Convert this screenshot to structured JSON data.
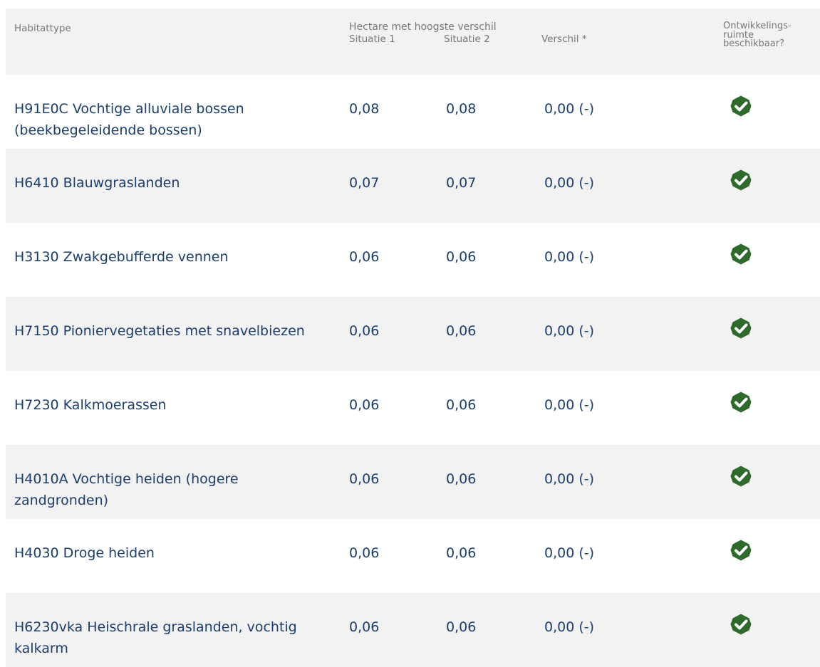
{
  "header": {
    "habitattype": "Habitattype",
    "group": "Hectare met hoogste verschil",
    "situatie1": "Situatie 1",
    "situatie2": "Situatie 2",
    "verschil": "Verschil *",
    "ontw_line1": "Ontwikkelings-",
    "ontw_line2": "ruimte",
    "ontw_line3": "beschikbaar?"
  },
  "rows": [
    {
      "name": "H91E0C Vochtige alluviale bossen (beekbegeleidende bossen)",
      "s1": "0,08",
      "s2": "0,08",
      "diff": "0,00 (-)",
      "available": true
    },
    {
      "name": "H6410 Blauwgraslanden",
      "s1": "0,07",
      "s2": "0,07",
      "diff": "0,00 (-)",
      "available": true
    },
    {
      "name": "H3130 Zwakgebufferde vennen",
      "s1": "0,06",
      "s2": "0,06",
      "diff": "0,00 (-)",
      "available": true
    },
    {
      "name": "H7150 Pioniervegetaties met snavelbiezen",
      "s1": "0,06",
      "s2": "0,06",
      "diff": "0,00 (-)",
      "available": true
    },
    {
      "name": "H7230 Kalkmoerassen",
      "s1": "0,06",
      "s2": "0,06",
      "diff": "0,00 (-)",
      "available": true
    },
    {
      "name": "H4010A Vochtige heiden (hogere zandgronden)",
      "s1": "0,06",
      "s2": "0,06",
      "diff": "0,00 (-)",
      "available": true
    },
    {
      "name": "H4030 Droge heiden",
      "s1": "0,06",
      "s2": "0,06",
      "diff": "0,00 (-)",
      "available": true
    },
    {
      "name": "H6230vka Heischrale graslanden, vochtig kalkarm",
      "s1": "0,06",
      "s2": "0,06",
      "diff": "0,00 (-)",
      "available": true
    }
  ],
  "colors": {
    "text": "#1c3d6e",
    "header_text": "#777777",
    "stripe": "#f2f2f2",
    "check": "#2e6b2b"
  },
  "icons": {
    "available": "check-circle-icon"
  }
}
